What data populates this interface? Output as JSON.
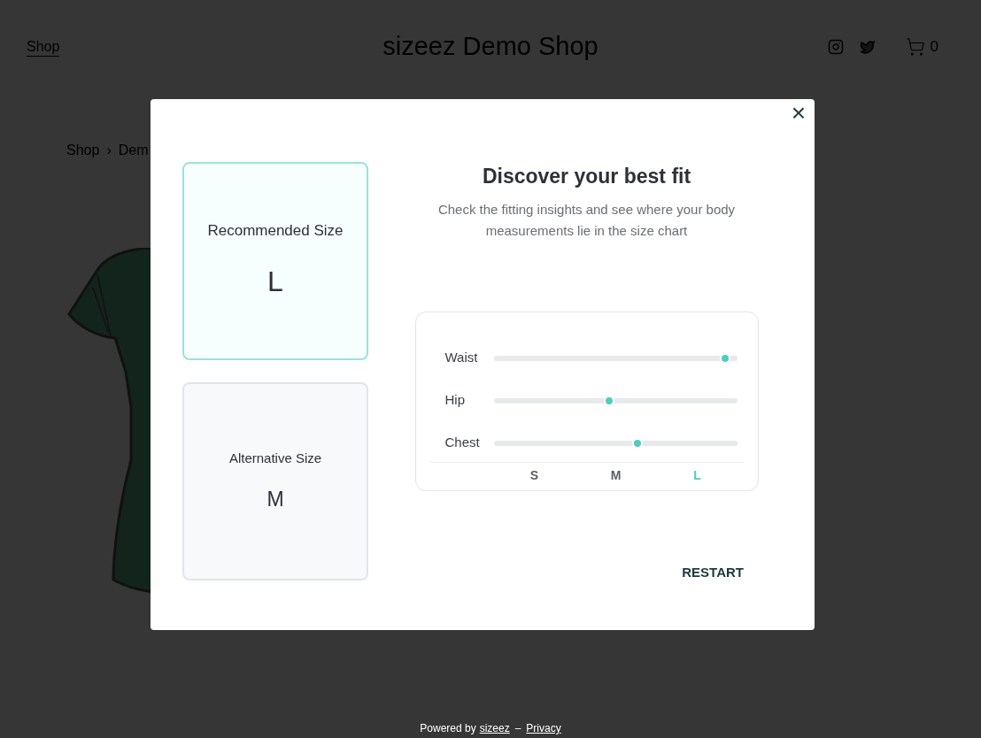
{
  "header": {
    "nav_link": "Shop",
    "shop_title": "sizeez Demo Shop",
    "cart_count": "0"
  },
  "breadcrumb": {
    "items": [
      "Shop",
      "Dem"
    ],
    "separator": "›"
  },
  "modal": {
    "close": "×",
    "sizes": [
      {
        "kind": "recommended",
        "label": "Recommended Size",
        "size": "L"
      },
      {
        "kind": "alternative",
        "label": "Alternative Size",
        "size": "M"
      }
    ],
    "title": "Discover your best fit",
    "subtitle": "Check the fitting insights and see where your body measurements lie in the size chart",
    "measurements": [
      {
        "name": "Waist",
        "level": 0.95
      },
      {
        "name": "Hip",
        "level": 0.475
      },
      {
        "name": "Chest",
        "level": 0.59
      }
    ],
    "scale": [
      {
        "label": "S",
        "selected": false
      },
      {
        "label": "M",
        "selected": false
      },
      {
        "label": "L",
        "selected": true
      }
    ],
    "restart": "RESTART"
  },
  "footer": {
    "powered_by": "Powered by",
    "brand_link": "sizeez",
    "dash": "–",
    "privacy_link": "Privacy"
  }
}
